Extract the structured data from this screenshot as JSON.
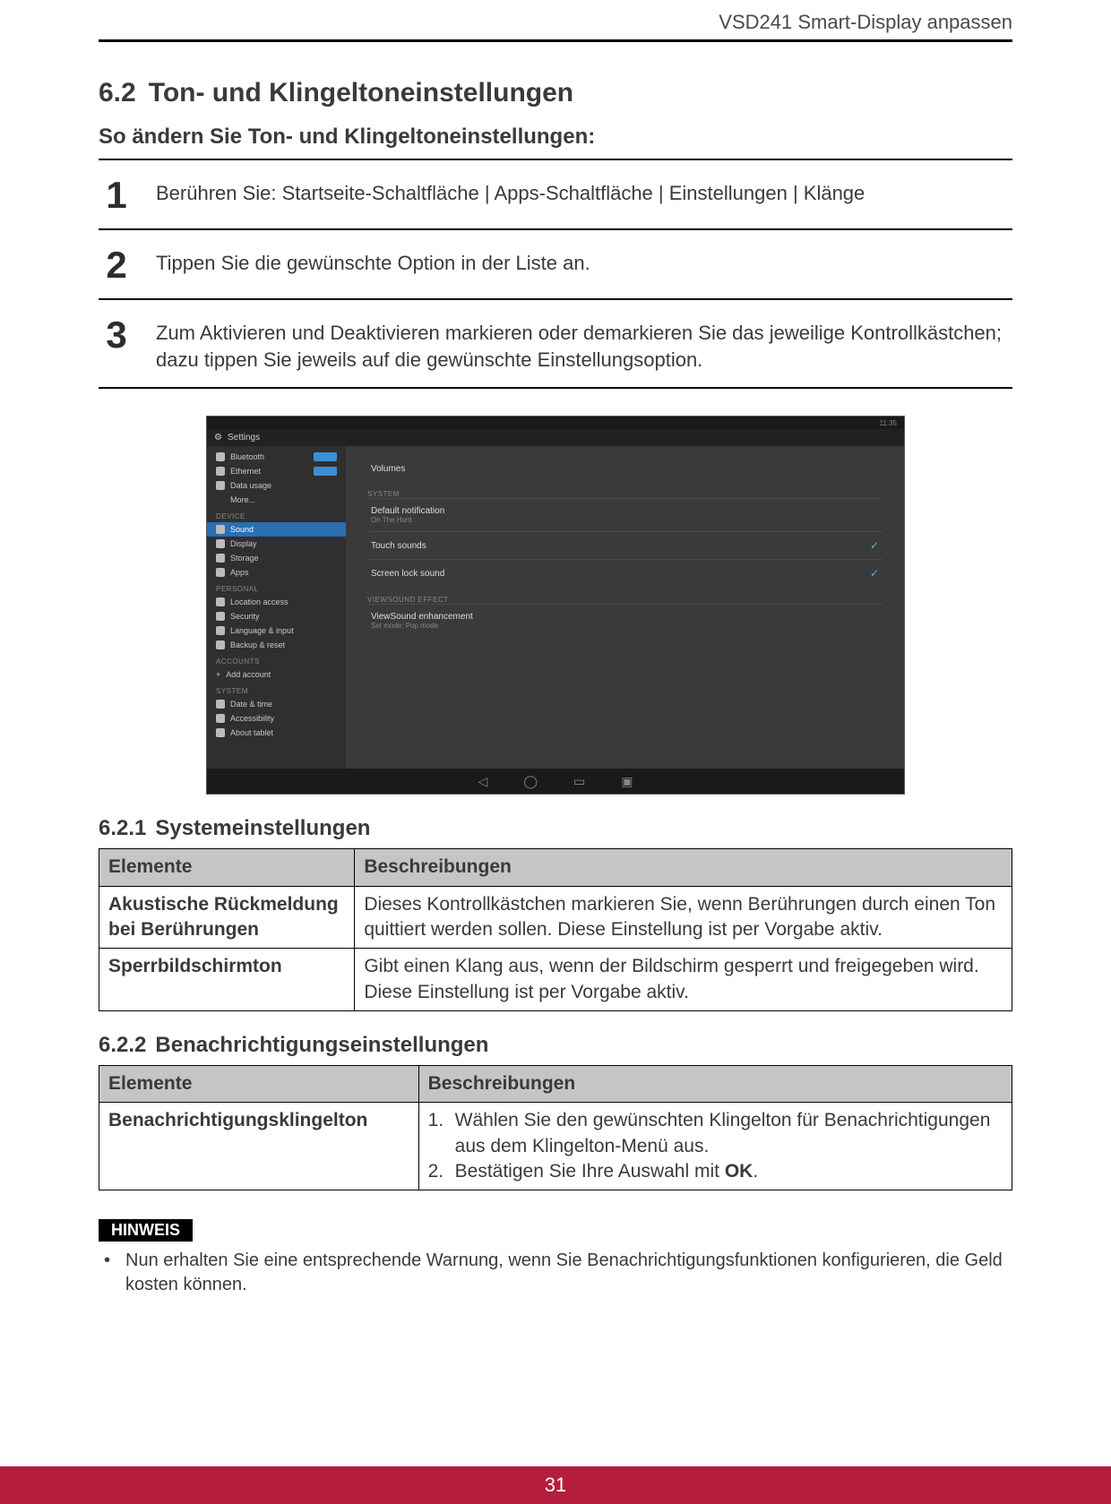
{
  "header": {
    "breadcrumb": "VSD241 Smart-Display anpassen"
  },
  "section": {
    "number": "6.2",
    "title": "Ton- und Klingeltoneinstellungen"
  },
  "intro": "So ändern Sie Ton- und Klingeltoneinstellungen:",
  "steps": [
    {
      "n": "1",
      "text": "Berühren Sie: Startseite-Schaltfläche | Apps-Schaltfläche | Einstellungen | Klänge"
    },
    {
      "n": "2",
      "text": "Tippen Sie die gewünschte Option in der Liste an."
    },
    {
      "n": "3",
      "text": "Zum Aktivieren und Deaktivieren markieren oder demarkieren Sie das jeweilige Kontrollkästchen; dazu tippen Sie jeweils auf die gewünschte Einstellungsoption."
    }
  ],
  "screenshot": {
    "app_title": "Settings",
    "status_time": "11:35",
    "sidebar": {
      "items_top": [
        {
          "label": "Bluetooth",
          "toggle": true
        },
        {
          "label": "Ethernet",
          "toggle": true
        },
        {
          "label": "Data usage",
          "toggle": false
        },
        {
          "label": "More...",
          "toggle": false
        }
      ],
      "cat_device": "DEVICE",
      "items_device": [
        {
          "label": "Sound",
          "selected": true
        },
        {
          "label": "Display"
        },
        {
          "label": "Storage"
        },
        {
          "label": "Apps"
        }
      ],
      "cat_personal": "PERSONAL",
      "items_personal": [
        {
          "label": "Location access"
        },
        {
          "label": "Security"
        },
        {
          "label": "Language & input"
        },
        {
          "label": "Backup & reset"
        }
      ],
      "cat_accounts": "ACCOUNTS",
      "items_accounts": [
        {
          "label": "Add account"
        }
      ],
      "cat_system": "SYSTEM",
      "items_system": [
        {
          "label": "Date & time"
        },
        {
          "label": "Accessibility"
        },
        {
          "label": "About tablet"
        }
      ]
    },
    "main": {
      "row_volumes": "Volumes",
      "cat_system": "SYSTEM",
      "row_default_notif": "Default notification",
      "row_default_notif_sub": "On The Hunt",
      "row_touch_sounds": "Touch sounds",
      "row_screen_lock": "Screen lock sound",
      "cat_viewsound": "VIEWSOUND EFFECT",
      "row_viewsound": "ViewSound enhancement",
      "row_viewsound_sub": "Set mode: Pop mode"
    }
  },
  "subsection1": {
    "number": "6.2.1",
    "title": "Systemeinstellungen",
    "headers": {
      "c1": "Elemente",
      "c2": "Beschreibungen"
    },
    "rows": [
      {
        "c1": "Akustische Rückmeldung bei Berührungen",
        "c2": "Dieses Kontrollkästchen markieren Sie, wenn Berührungen durch einen Ton quittiert werden sollen. Diese Einstellung ist per Vorgabe aktiv."
      },
      {
        "c1": "Sperrbildschirmton",
        "c2": "Gibt einen Klang aus, wenn der Bildschirm gesperrt und freigegeben wird. Diese Einstellung ist per Vorgabe aktiv."
      }
    ]
  },
  "subsection2": {
    "number": "6.2.2",
    "title": "Benachrichtigungseinstellungen",
    "headers": {
      "c1": "Elemente",
      "c2": "Beschreibungen"
    },
    "row": {
      "c1": "Benachrichtigungsklingelton",
      "li1": "Wählen Sie den gewünschten Klingelton für Benachrichtigungen aus dem Klingelton-Menü aus.",
      "li2_pre": "Bestätigen Sie Ihre Auswahl mit ",
      "li2_b": "OK",
      "li2_post": "."
    }
  },
  "note": {
    "label": "HINWEIS",
    "text": "Nun erhalten Sie eine entsprechende Warnung, wenn Sie Benachrichtigungsfunktionen konfigurieren, die Geld kosten können."
  },
  "page_number": "31"
}
